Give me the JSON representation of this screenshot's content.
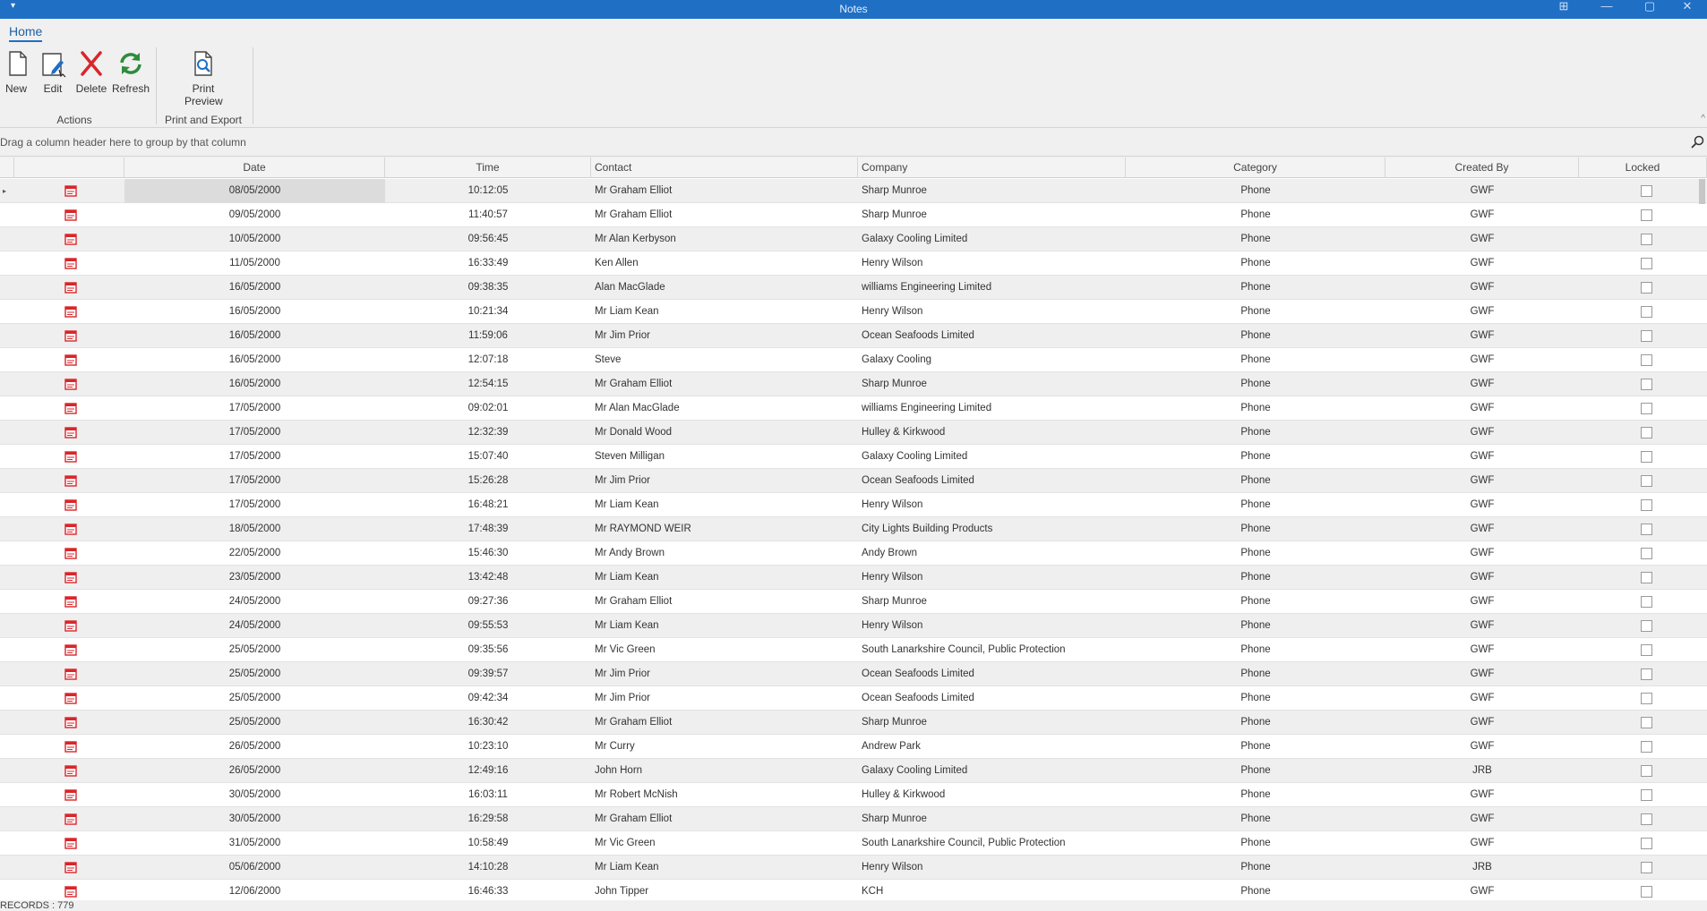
{
  "window": {
    "title": "Notes",
    "quick_access_glyph": "▾",
    "minimize": "—",
    "maximize": "▢",
    "close": "✕",
    "layout_glyph": "⊞"
  },
  "ribbon": {
    "tab": "Home",
    "buttons": {
      "new": "New",
      "edit": "Edit",
      "delete": "Delete",
      "refresh": "Refresh",
      "print_line1": "Print",
      "print_line2": "Preview"
    },
    "groups": {
      "actions": "Actions",
      "print_export": "Print and Export"
    },
    "collapse": "^"
  },
  "groupbar": {
    "hint": "Drag a column header here to group by that column"
  },
  "grid": {
    "columns": {
      "date": "Date",
      "time": "Time",
      "contact": "Contact",
      "company": "Company",
      "category": "Category",
      "created_by": "Created By",
      "locked": "Locked"
    },
    "rows": [
      {
        "date": "08/05/2000",
        "time": "10:12:05",
        "contact": "Mr Graham Elliot",
        "company": "Sharp Munroe",
        "category": "Phone",
        "created_by": "GWF"
      },
      {
        "date": "09/05/2000",
        "time": "11:40:57",
        "contact": "Mr Graham Elliot",
        "company": "Sharp Munroe",
        "category": "Phone",
        "created_by": "GWF"
      },
      {
        "date": "10/05/2000",
        "time": "09:56:45",
        "contact": "Mr Alan Kerbyson",
        "company": "Galaxy Cooling Limited",
        "category": "Phone",
        "created_by": "GWF"
      },
      {
        "date": "11/05/2000",
        "time": "16:33:49",
        "contact": "Ken Allen",
        "company": "Henry Wilson",
        "category": "Phone",
        "created_by": "GWF"
      },
      {
        "date": "16/05/2000",
        "time": "09:38:35",
        "contact": "Alan MacGlade",
        "company": "williams Engineering Limited",
        "category": "Phone",
        "created_by": "GWF"
      },
      {
        "date": "16/05/2000",
        "time": "10:21:34",
        "contact": "Mr Liam Kean",
        "company": "Henry Wilson",
        "category": "Phone",
        "created_by": "GWF"
      },
      {
        "date": "16/05/2000",
        "time": "11:59:06",
        "contact": "Mr Jim Prior",
        "company": "Ocean Seafoods Limited",
        "category": "Phone",
        "created_by": "GWF"
      },
      {
        "date": "16/05/2000",
        "time": "12:07:18",
        "contact": "Steve",
        "company": "Galaxy Cooling",
        "category": "Phone",
        "created_by": "GWF"
      },
      {
        "date": "16/05/2000",
        "time": "12:54:15",
        "contact": "Mr Graham Elliot",
        "company": "Sharp Munroe",
        "category": "Phone",
        "created_by": "GWF"
      },
      {
        "date": "17/05/2000",
        "time": "09:02:01",
        "contact": "Mr Alan MacGlade",
        "company": "williams Engineering Limited",
        "category": "Phone",
        "created_by": "GWF"
      },
      {
        "date": "17/05/2000",
        "time": "12:32:39",
        "contact": "Mr Donald Wood",
        "company": "Hulley & Kirkwood",
        "category": "Phone",
        "created_by": "GWF"
      },
      {
        "date": "17/05/2000",
        "time": "15:07:40",
        "contact": "Steven Milligan",
        "company": "Galaxy Cooling Limited",
        "category": "Phone",
        "created_by": "GWF"
      },
      {
        "date": "17/05/2000",
        "time": "15:26:28",
        "contact": "Mr Jim Prior",
        "company": "Ocean Seafoods Limited",
        "category": "Phone",
        "created_by": "GWF"
      },
      {
        "date": "17/05/2000",
        "time": "16:48:21",
        "contact": "Mr Liam Kean",
        "company": "Henry Wilson",
        "category": "Phone",
        "created_by": "GWF"
      },
      {
        "date": "18/05/2000",
        "time": "17:48:39",
        "contact": "Mr RAYMOND WEIR",
        "company": "City Lights Building Products",
        "category": "Phone",
        "created_by": "GWF"
      },
      {
        "date": "22/05/2000",
        "time": "15:46:30",
        "contact": "Mr Andy Brown",
        "company": "Andy Brown",
        "category": "Phone",
        "created_by": "GWF"
      },
      {
        "date": "23/05/2000",
        "time": "13:42:48",
        "contact": "Mr Liam Kean",
        "company": "Henry Wilson",
        "category": "Phone",
        "created_by": "GWF"
      },
      {
        "date": "24/05/2000",
        "time": "09:27:36",
        "contact": "Mr Graham Elliot",
        "company": "Sharp Munroe",
        "category": "Phone",
        "created_by": "GWF"
      },
      {
        "date": "24/05/2000",
        "time": "09:55:53",
        "contact": "Mr Liam Kean",
        "company": "Henry Wilson",
        "category": "Phone",
        "created_by": "GWF"
      },
      {
        "date": "25/05/2000",
        "time": "09:35:56",
        "contact": "Mr Vic Green",
        "company": "South Lanarkshire Council, Public Protection",
        "category": "Phone",
        "created_by": "GWF"
      },
      {
        "date": "25/05/2000",
        "time": "09:39:57",
        "contact": "Mr Jim Prior",
        "company": "Ocean Seafoods Limited",
        "category": "Phone",
        "created_by": "GWF"
      },
      {
        "date": "25/05/2000",
        "time": "09:42:34",
        "contact": "Mr Jim Prior",
        "company": "Ocean Seafoods Limited",
        "category": "Phone",
        "created_by": "GWF"
      },
      {
        "date": "25/05/2000",
        "time": "16:30:42",
        "contact": "Mr Graham Elliot",
        "company": "Sharp Munroe",
        "category": "Phone",
        "created_by": "GWF"
      },
      {
        "date": "26/05/2000",
        "time": "10:23:10",
        "contact": "Mr Curry",
        "company": "Andrew Park",
        "category": "Phone",
        "created_by": "GWF"
      },
      {
        "date": "26/05/2000",
        "time": "12:49:16",
        "contact": "John Horn",
        "company": "Galaxy Cooling Limited",
        "category": "Phone",
        "created_by": "JRB"
      },
      {
        "date": "30/05/2000",
        "time": "16:03:11",
        "contact": "Mr Robert McNish",
        "company": "Hulley & Kirkwood",
        "category": "Phone",
        "created_by": "GWF"
      },
      {
        "date": "30/05/2000",
        "time": "16:29:58",
        "contact": "Mr Graham Elliot",
        "company": "Sharp Munroe",
        "category": "Phone",
        "created_by": "GWF"
      },
      {
        "date": "31/05/2000",
        "time": "10:58:49",
        "contact": "Mr Vic Green",
        "company": "South Lanarkshire Council, Public Protection",
        "category": "Phone",
        "created_by": "GWF"
      },
      {
        "date": "05/06/2000",
        "time": "14:10:28",
        "contact": "Mr Liam Kean",
        "company": "Henry Wilson",
        "category": "Phone",
        "created_by": "JRB"
      },
      {
        "date": "12/06/2000",
        "time": "16:46:33",
        "contact": "John Tipper",
        "company": "KCH",
        "category": "Phone",
        "created_by": "GWF"
      }
    ]
  },
  "status": {
    "records": "RECORDS : 779"
  },
  "colors": {
    "titlebar": "#1f6fc5",
    "delete_red": "#d9262b",
    "refresh_green": "#2e8b3d",
    "edit_blue": "#1f6fc5",
    "note_red": "#d9262b"
  }
}
